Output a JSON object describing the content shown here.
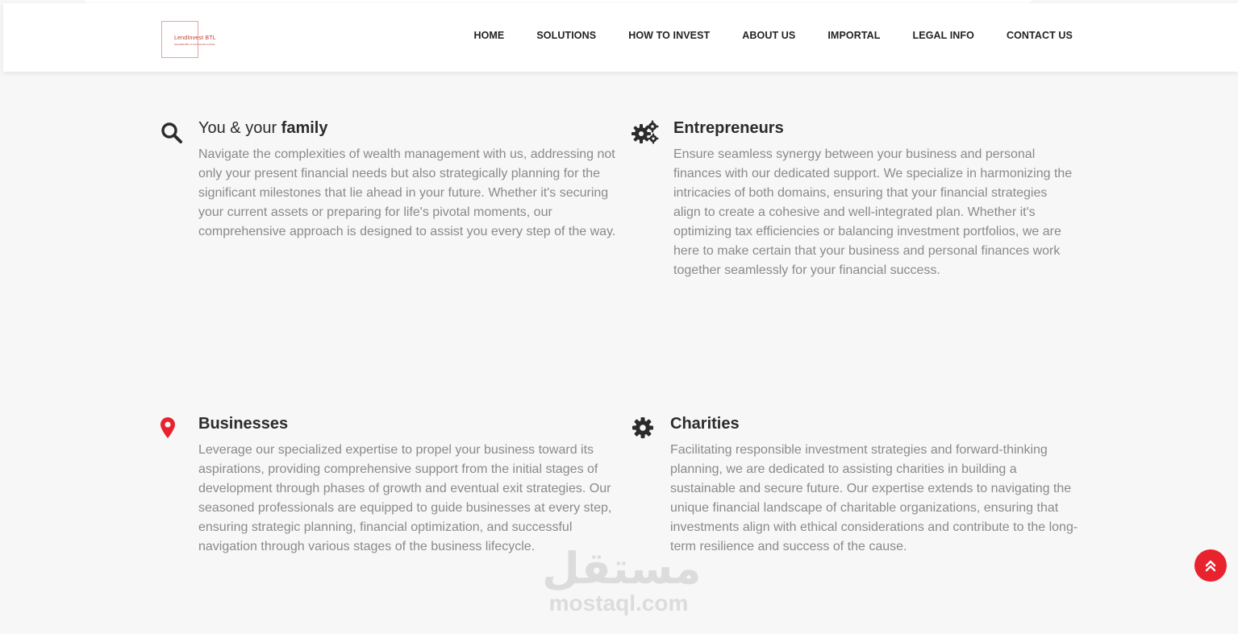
{
  "header": {
    "logo_name": "LendInvest BTL",
    "logo_tagline": "Specialist BTL & Commercial Lending",
    "nav": [
      "HOME",
      "SOLUTIONS",
      "HOW TO INVEST",
      "ABOUT US",
      "IMPORTAL",
      "LEGAL INFO",
      "CONTACT US"
    ]
  },
  "features": {
    "family": {
      "title_light": "You & your",
      "title_bold": "family",
      "icon": "search-icon",
      "text": "Navigate the complexities of wealth management with us, addressing not only your present financial needs but also strategically planning for the significant milestones that lie ahead in your future. Whether it's securing your current assets or preparing for life's pivotal moments, our comprehensive approach is designed to assist you every step of the way."
    },
    "entrepreneurs": {
      "title": "Entrepreneurs",
      "icon": "gears-icon",
      "text": "Ensure seamless synergy between your business and personal finances with our dedicated support. We specialize in harmonizing the intricacies of both domains, ensuring that your financial strategies align to create a cohesive and well-integrated plan. Whether it's optimizing tax efficiencies or balancing investment portfolios, we are here to make certain that your business and personal finances work together seamlessly for your financial success."
    },
    "businesses": {
      "title": "Businesses",
      "icon": "map-pin-icon",
      "text": "Leverage our specialized expertise to propel your business toward its aspirations, providing comprehensive support from the initial stages of development through phases of growth and eventual exit strategies. Our seasoned professionals are equipped to guide businesses at every step, ensuring strategic planning, financial optimization, and successful navigation through various stages of the business lifecycle."
    },
    "charities": {
      "title": "Charities",
      "icon": "gear-icon",
      "text": "Facilitating responsible investment strategies and forward-thinking planning, we are dedicated to assisting charities in building a sustainable and secure future. Our expertise extends to navigating the unique financial landscape of charitable organizations, ensuring that investments align with ethical considerations and contribute to the long-term resilience and success of the cause."
    }
  },
  "watermark": {
    "arabic": "مستقل",
    "latin": "mostaql.com"
  },
  "colors": {
    "accent": "#e8232e",
    "heading": "#2b2b2b",
    "body_text": "#8a8a8a",
    "background": "#f7f7f7"
  }
}
